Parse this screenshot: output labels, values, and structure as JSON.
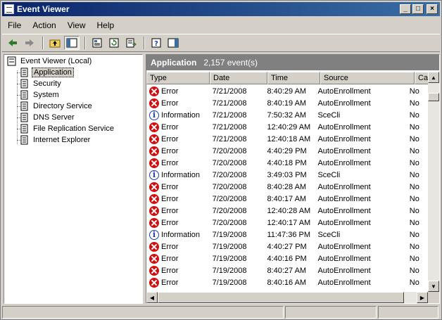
{
  "window": {
    "title": "Event Viewer"
  },
  "menu": [
    {
      "label": "File"
    },
    {
      "label": "Action"
    },
    {
      "label": "View"
    },
    {
      "label": "Help"
    }
  ],
  "toolbar": [
    {
      "name": "back-icon"
    },
    {
      "name": "forward-icon"
    },
    {
      "name": "up-folder-icon"
    },
    {
      "name": "show-hide-tree-icon"
    },
    {
      "name": "properties-icon"
    },
    {
      "name": "refresh-icon"
    },
    {
      "name": "export-list-icon"
    },
    {
      "name": "help-icon"
    },
    {
      "name": "action-pane-icon"
    }
  ],
  "tree": {
    "root": "Event Viewer (Local)",
    "items": [
      {
        "label": "Application"
      },
      {
        "label": "Security"
      },
      {
        "label": "System"
      },
      {
        "label": "Directory Service"
      },
      {
        "label": "DNS Server"
      },
      {
        "label": "File Replication Service"
      },
      {
        "label": "Internet Explorer"
      }
    ]
  },
  "pane": {
    "name": "Application",
    "count": "2,157 event(s)"
  },
  "columns": {
    "type": "Type",
    "date": "Date",
    "time": "Time",
    "source": "Source",
    "category": "Ca"
  },
  "rows": [
    {
      "type": "Error",
      "icon": "error",
      "date": "7/21/2008",
      "time": "8:40:29 AM",
      "source": "AutoEnrollment",
      "category": "No"
    },
    {
      "type": "Error",
      "icon": "error",
      "date": "7/21/2008",
      "time": "8:40:19 AM",
      "source": "AutoEnrollment",
      "category": "No"
    },
    {
      "type": "Information",
      "icon": "info",
      "date": "7/21/2008",
      "time": "7:50:32 AM",
      "source": "SceCli",
      "category": "No"
    },
    {
      "type": "Error",
      "icon": "error",
      "date": "7/21/2008",
      "time": "12:40:29 AM",
      "source": "AutoEnrollment",
      "category": "No"
    },
    {
      "type": "Error",
      "icon": "error",
      "date": "7/21/2008",
      "time": "12:40:18 AM",
      "source": "AutoEnrollment",
      "category": "No"
    },
    {
      "type": "Error",
      "icon": "error",
      "date": "7/20/2008",
      "time": "4:40:29 PM",
      "source": "AutoEnrollment",
      "category": "No"
    },
    {
      "type": "Error",
      "icon": "error",
      "date": "7/20/2008",
      "time": "4:40:18 PM",
      "source": "AutoEnrollment",
      "category": "No"
    },
    {
      "type": "Information",
      "icon": "info",
      "date": "7/20/2008",
      "time": "3:49:03 PM",
      "source": "SceCli",
      "category": "No"
    },
    {
      "type": "Error",
      "icon": "error",
      "date": "7/20/2008",
      "time": "8:40:28 AM",
      "source": "AutoEnrollment",
      "category": "No"
    },
    {
      "type": "Error",
      "icon": "error",
      "date": "7/20/2008",
      "time": "8:40:17 AM",
      "source": "AutoEnrollment",
      "category": "No"
    },
    {
      "type": "Error",
      "icon": "error",
      "date": "7/20/2008",
      "time": "12:40:28 AM",
      "source": "AutoEnrollment",
      "category": "No"
    },
    {
      "type": "Error",
      "icon": "error",
      "date": "7/20/2008",
      "time": "12:40:17 AM",
      "source": "AutoEnrollment",
      "category": "No"
    },
    {
      "type": "Information",
      "icon": "info",
      "date": "7/19/2008",
      "time": "11:47:36 PM",
      "source": "SceCli",
      "category": "No"
    },
    {
      "type": "Error",
      "icon": "error",
      "date": "7/19/2008",
      "time": "4:40:27 PM",
      "source": "AutoEnrollment",
      "category": "No"
    },
    {
      "type": "Error",
      "icon": "error",
      "date": "7/19/2008",
      "time": "4:40:16 PM",
      "source": "AutoEnrollment",
      "category": "No"
    },
    {
      "type": "Error",
      "icon": "error",
      "date": "7/19/2008",
      "time": "8:40:27 AM",
      "source": "AutoEnrollment",
      "category": "No"
    },
    {
      "type": "Error",
      "icon": "error",
      "date": "7/19/2008",
      "time": "8:40:16 AM",
      "source": "AutoEnrollment",
      "category": "No"
    }
  ],
  "colors": {
    "title_start": "#0a246a",
    "title_end": "#3a6ea5",
    "error_red": "#d01010",
    "info_blue": "#1f3fa8",
    "pane_header": "#808080"
  }
}
